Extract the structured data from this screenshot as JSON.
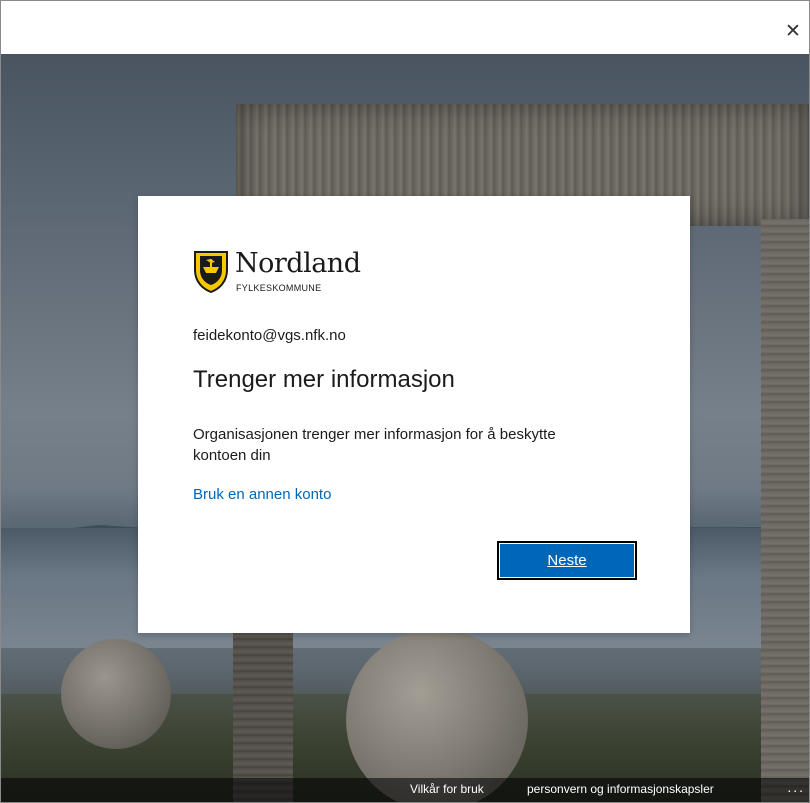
{
  "window": {
    "close_icon": "close-icon",
    "close_glyph": "✕"
  },
  "logo": {
    "name": "Nordland",
    "subtitle": "FYLKESKOMMUNE",
    "shield_colors": {
      "fill": "#f6c800",
      "outline": "#1a1a1a"
    }
  },
  "dialog": {
    "account": "feidekonto@vgs.nfk.no",
    "title": "Trenger mer informasjon",
    "description": "Organisasjonen trenger mer informasjon for å beskytte kontoen din",
    "use_other_account": "Bruk en annen konto",
    "next_button": "Neste"
  },
  "footer": {
    "terms": "Vilkår for bruk",
    "privacy": "personvern og informasjonskapsler",
    "more": "..."
  },
  "colors": {
    "accent": "#0067b8",
    "text": "#1b1b1b"
  }
}
